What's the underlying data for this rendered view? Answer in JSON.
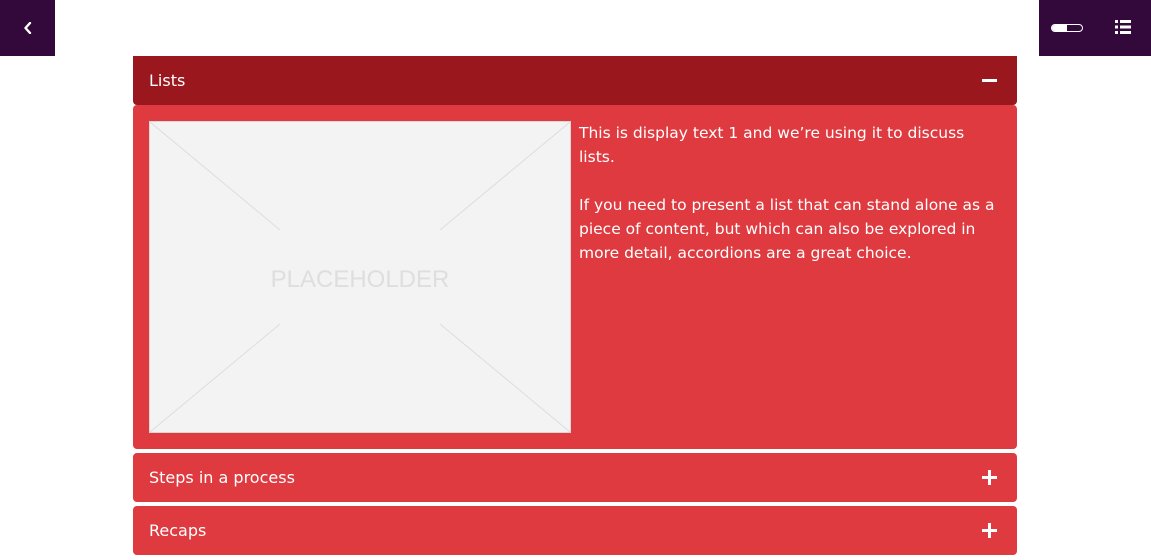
{
  "nav": {
    "back_icon": "chevron-left-icon",
    "menu_icon": "list-menu-icon",
    "progress_fraction": 0.5
  },
  "colors": {
    "nav_bg": "#33093b",
    "accordion_bg": "#de3a40",
    "accordion_open_header_bg": "#9a171d",
    "placeholder_bg": "#f3f3f3"
  },
  "accordion": {
    "items": [
      {
        "title": "Lists",
        "expanded": true,
        "toggle_icon": "minus-icon",
        "image_label": "PLACEHOLDER",
        "paragraphs": [
          "This is display text 1 and we’re using it to discuss lists.",
          "If you need to present a list that can stand alone as a piece of content, but which can also be explored in more detail, accordions are a great choice."
        ]
      },
      {
        "title": "Steps in a process",
        "expanded": false,
        "toggle_icon": "plus-icon"
      },
      {
        "title": "Recaps",
        "expanded": false,
        "toggle_icon": "plus-icon"
      }
    ]
  }
}
